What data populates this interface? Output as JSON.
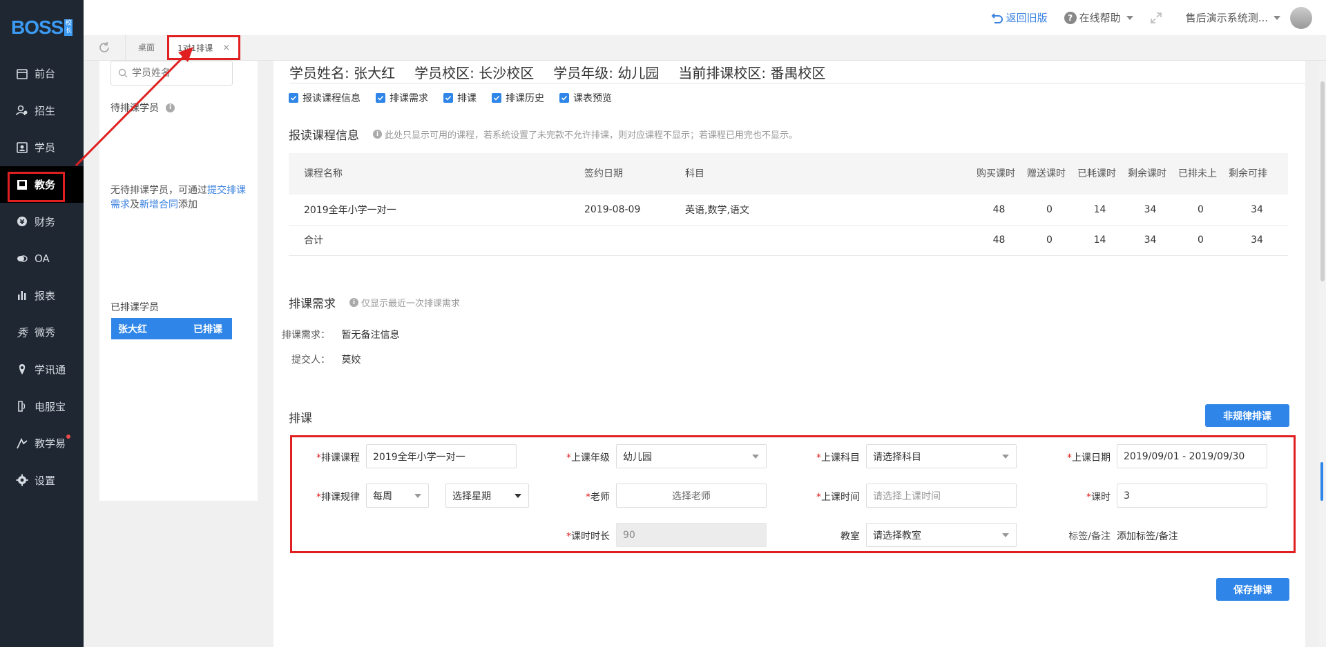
{
  "app": {
    "logo": "BOSS",
    "logo_sub": "校长"
  },
  "sidebar": {
    "items": [
      {
        "label": "前台",
        "icon": "calendar-icon"
      },
      {
        "label": "招生",
        "icon": "user-plus-icon"
      },
      {
        "label": "学员",
        "icon": "id-card-icon"
      },
      {
        "label": "教务",
        "icon": "book-icon",
        "active": true
      },
      {
        "label": "财务",
        "icon": "yen-icon"
      },
      {
        "label": "OA",
        "icon": "chat-icon"
      },
      {
        "label": "报表",
        "icon": "bar-chart-icon"
      },
      {
        "label": "微秀",
        "icon": "show-icon"
      },
      {
        "label": "学讯通",
        "icon": "location-icon"
      },
      {
        "label": "电服宝",
        "icon": "phone-icon"
      },
      {
        "label": "教学易",
        "icon": "teach-icon",
        "dot": true
      },
      {
        "label": "设置",
        "icon": "gear-icon"
      }
    ]
  },
  "topbar": {
    "back_old": "返回旧版",
    "help": "在线帮助",
    "user": "售后演示系统测..."
  },
  "tabs": [
    {
      "label": "桌面"
    },
    {
      "label": "1对1排课",
      "active": true
    }
  ],
  "left": {
    "search_placeholder": "学员姓名",
    "pending_title": "待排课学员",
    "empty_text_1": "无待排课学员，可通过",
    "empty_link_1": "提交排课需求",
    "empty_text_2": "及",
    "empty_link_2": "新增合同",
    "empty_text_3": "添加",
    "scheduled_title": "已排课学员",
    "student_name": "张大红",
    "student_status": "已排课"
  },
  "header": {
    "name": "学员姓名: 张大红",
    "campus": "学员校区: 长沙校区",
    "grade": "学员年级: 幼儿园",
    "current_campus": "当前排课校区: 番禺校区"
  },
  "checks": [
    "报读课程信息",
    "排课需求",
    "排课",
    "排课历史",
    "课表预览"
  ],
  "course_section": {
    "title": "报读课程信息",
    "note": "此处只显示可用的课程，若系统设置了未完款不允许排课，则对应课程不显示；若课程已用完也不显示。",
    "columns": [
      "课程名称",
      "签约日期",
      "科目",
      "购买课时",
      "赠送课时",
      "已耗课时",
      "剩余课时",
      "已排未上",
      "剩余可排"
    ],
    "rows": [
      [
        "2019全年小学一对一",
        "2019-08-09",
        "英语,数学,语文",
        "48",
        "0",
        "14",
        "34",
        "0",
        "34"
      ],
      [
        "合计",
        "",
        "",
        "48",
        "0",
        "14",
        "34",
        "0",
        "34"
      ]
    ]
  },
  "req_section": {
    "title": "排课需求",
    "note": "仅显示最近一次排课需求",
    "req_label": "排课需求：",
    "req_value": "暂无备注信息",
    "submitter_label": "提交人：",
    "submitter_value": "莫姣"
  },
  "schedule_section": {
    "title": "排课",
    "irregular_button": "非规律排课",
    "save_button": "保存排课",
    "fields": {
      "course_label": "排课课程",
      "course_value": "2019全年小学一对一",
      "grade_label": "上课年级",
      "grade_value": "幼儿园",
      "subject_label": "上课科目",
      "subject_placeholder": "请选择科目",
      "date_label": "上课日期",
      "date_value": "2019/09/01 - 2019/09/30",
      "rule_label": "排课规律",
      "rule_value": "每周",
      "weekday_placeholder": "选择星期",
      "teacher_label": "老师",
      "teacher_placeholder": "选择老师",
      "time_label": "上课时间",
      "time_placeholder": "请选择上课时间",
      "hours_label": "课时",
      "hours_value": "3",
      "duration_label": "课时时长",
      "duration_value": "90",
      "room_label": "教室",
      "room_placeholder": "请选择教室",
      "tag_label": "标签/备注",
      "tag_link": "添加标签/备注"
    }
  },
  "colors": {
    "accent": "#2f86e8",
    "annotation": "#e02020",
    "sidebar": "#1f2732"
  }
}
